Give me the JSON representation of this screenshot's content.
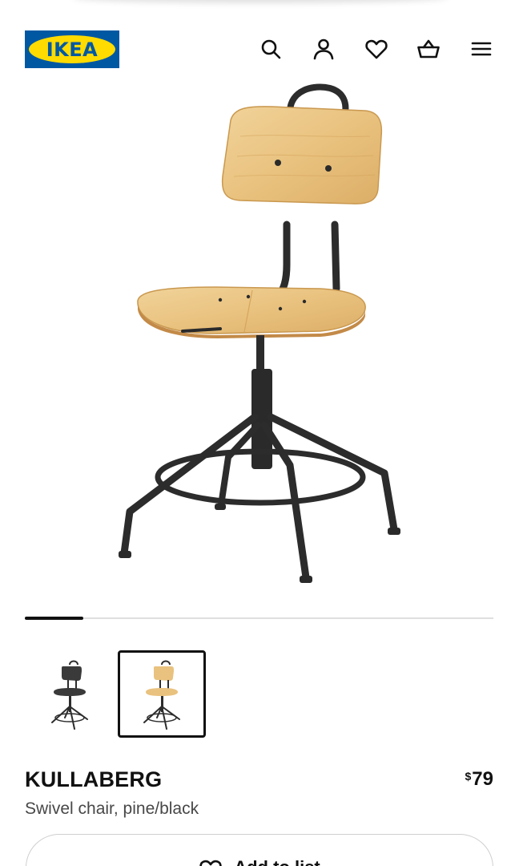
{
  "brand": {
    "logo_text": "IKEA",
    "blue": "#0058a3",
    "yellow": "#ffdb00"
  },
  "header": {
    "icons": [
      "search-icon",
      "user-icon",
      "heart-icon",
      "basket-icon",
      "menu-icon"
    ]
  },
  "gallery": {
    "progress": 0.125,
    "thumbnails": [
      {
        "name": "chair-black",
        "selected": false
      },
      {
        "name": "chair-pine-black",
        "selected": true
      }
    ]
  },
  "product": {
    "name": "KULLABERG",
    "description": "Swivel chair, pine/black",
    "price_currency": "$",
    "price_amount": "79"
  },
  "actions": {
    "add_to_list_label": "Add to list"
  }
}
